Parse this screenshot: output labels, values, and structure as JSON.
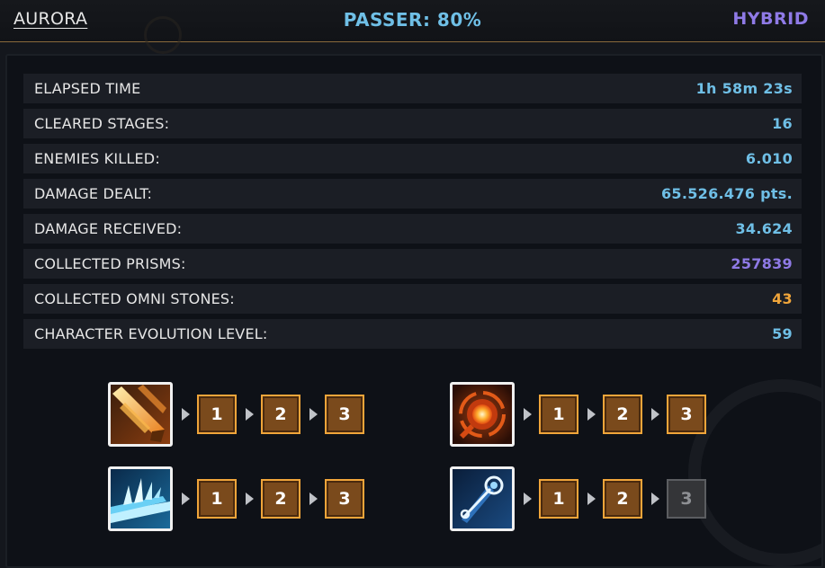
{
  "header": {
    "character": "AURORA",
    "passer": "PASSER: 80%",
    "mode": "HYBRID"
  },
  "stats": [
    {
      "label": "ELAPSED TIME",
      "value": "1h 58m 23s",
      "color": "#6fbfe6"
    },
    {
      "label": "CLEARED STAGES:",
      "value": "16",
      "color": "#6fbfe6"
    },
    {
      "label": "ENEMIES KILLED:",
      "value": "6.010",
      "color": "#6fbfe6"
    },
    {
      "label": "DAMAGE DEALT:",
      "value": "65.526.476 pts.",
      "color": "#6fbfe6"
    },
    {
      "label": "DAMAGE RECEIVED:",
      "value": "34.624",
      "color": "#6fbfe6"
    },
    {
      "label": "COLLECTED PRISMS:",
      "value": "257839",
      "color": "#8f7ae6"
    },
    {
      "label": "COLLECTED OMNI STONES:",
      "value": "43",
      "color": "#f0a53a"
    },
    {
      "label": "CHARACTER EVOLUTION LEVEL:",
      "value": "59",
      "color": "#6fbfe6"
    }
  ],
  "skills": [
    {
      "icon": "sword-slash-icon",
      "levels": [
        {
          "label": "1",
          "unlocked": true
        },
        {
          "label": "2",
          "unlocked": true
        },
        {
          "label": "3",
          "unlocked": true
        }
      ]
    },
    {
      "icon": "fireball-icon",
      "levels": [
        {
          "label": "1",
          "unlocked": true
        },
        {
          "label": "2",
          "unlocked": true
        },
        {
          "label": "3",
          "unlocked": true
        }
      ]
    },
    {
      "icon": "ice-wave-icon",
      "levels": [
        {
          "label": "1",
          "unlocked": true
        },
        {
          "label": "2",
          "unlocked": true
        },
        {
          "label": "3",
          "unlocked": true
        }
      ]
    },
    {
      "icon": "comet-icon",
      "levels": [
        {
          "label": "1",
          "unlocked": true
        },
        {
          "label": "2",
          "unlocked": true
        },
        {
          "label": "3",
          "unlocked": false
        }
      ]
    }
  ]
}
